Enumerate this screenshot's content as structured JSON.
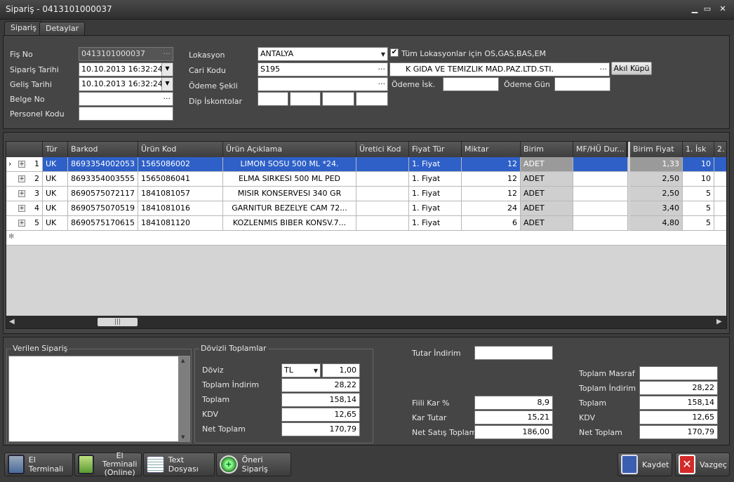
{
  "window": {
    "title": "Sipariş - 0413101000037",
    "min": "▁",
    "max": "▭",
    "close": "✕"
  },
  "tabs": [
    "Sipariş",
    "Detaylar"
  ],
  "header": {
    "fis_no_label": "Fiş No",
    "fis_no": "0413101000037",
    "siparis_tarihi_label": "Sipariş Tarihi",
    "siparis_tarihi": "10.10.2013 16:32:24",
    "gelis_tarihi_label": "Geliş Tarihi",
    "gelis_tarihi": "10.10.2013 16:32:24",
    "belge_no_label": "Belge No",
    "belge_no": "",
    "personel_kodu_label": "Personel Kodu",
    "personel_kodu": "",
    "lokasyon_label": "Lokasyon",
    "lokasyon": "ANTALYA",
    "tum_lokasyon_label": "Tüm Lokasyonlar için OS,GAS,BAS,EM",
    "cari_kodu_label": "Cari Kodu",
    "cari_kodu": "S195",
    "cari_unvan": "K GIDA VE TEMIZLIK MAD.PAZ.LTD.STI.",
    "akil_kupu": "Akıl Küpü",
    "odeme_sekli_label": "Ödeme Şekli",
    "odeme_sekli": "",
    "odeme_isk_label": "Ödeme İsk.",
    "odeme_gun_label": "Ödeme Gün",
    "dip_iskontolar_label": "Dip İskontolar"
  },
  "grid": {
    "columns": [
      "Tür",
      "Barkod",
      "Ürün Kod",
      "Ürün Açıklama",
      "Üretici Kod",
      "Fiyat Tür",
      "Miktar",
      "Birim",
      "MF/HÜ Dur...",
      "Birim Fiyat",
      "1. İsk",
      "2."
    ],
    "rows": [
      {
        "no": "1",
        "tur": "UK",
        "barkod": "8693354002053",
        "urun_kod": "1565086002",
        "aciklama": "LIMON SOSU 500 ML *24.",
        "uretici": "",
        "fiyat_tur": "1. Fiyat",
        "miktar": "12",
        "birim": "ADET",
        "mf": "",
        "birim_fiyat": "1,33",
        "isk1": "10"
      },
      {
        "no": "2",
        "tur": "UK",
        "barkod": "8693354003555",
        "urun_kod": "1565086041",
        "aciklama": "ELMA SIRKESI 500 ML PED",
        "uretici": "",
        "fiyat_tur": "1. Fiyat",
        "miktar": "12",
        "birim": "ADET",
        "mf": "",
        "birim_fiyat": "2,50",
        "isk1": "10"
      },
      {
        "no": "3",
        "tur": "UK",
        "barkod": "8690575072117",
        "urun_kod": "1841081057",
        "aciklama": "MISIR KONSERVESI 340 GR",
        "uretici": "",
        "fiyat_tur": "1. Fiyat",
        "miktar": "12",
        "birim": "ADET",
        "mf": "",
        "birim_fiyat": "2,50",
        "isk1": "5"
      },
      {
        "no": "4",
        "tur": "UK",
        "barkod": "8690575070519",
        "urun_kod": "1841081016",
        "aciklama": "GARNITUR BEZELYE CAM 72...",
        "uretici": "",
        "fiyat_tur": "1. Fiyat",
        "miktar": "24",
        "birim": "ADET",
        "mf": "",
        "birim_fiyat": "3,40",
        "isk1": "5"
      },
      {
        "no": "5",
        "tur": "UK",
        "barkod": "8690575170615",
        "urun_kod": "1841081120",
        "aciklama": "KOZLENMIS BIBER KONSV.7...",
        "uretici": "",
        "fiyat_tur": "1. Fiyat",
        "miktar": "6",
        "birim": "ADET",
        "mf": "",
        "birim_fiyat": "4,80",
        "isk1": "5"
      }
    ]
  },
  "verilen_siparis": {
    "title": "Verilen Sipariş"
  },
  "dovizli": {
    "title": "Dövizli Toplamlar",
    "doviz_label": "Döviz",
    "doviz": "TL",
    "kur": "1,00",
    "toplam_indirim_label": "Toplam İndirim",
    "toplam_indirim": "28,22",
    "toplam_label": "Toplam",
    "toplam": "158,14",
    "kdv_label": "KDV",
    "kdv": "12,65",
    "net_toplam_label": "Net Toplam",
    "net_toplam": "170,79"
  },
  "middle": {
    "tutar_indirim_label": "Tutar İndirim",
    "tutar_indirim": "",
    "fiili_kar_label": "Fiili Kar %",
    "fiili_kar": "8,9",
    "kar_tutar_label": "Kar Tutar",
    "kar_tutar": "15,21",
    "net_satis_label": "Net Satış Toplam",
    "net_satis": "186,00"
  },
  "right": {
    "toplam_masraf_label": "Toplam Masraf",
    "toplam_masraf": "",
    "toplam_indirim_label": "Toplam İndirim",
    "toplam_indirim": "28,22",
    "toplam_label": "Toplam",
    "toplam": "158,14",
    "kdv_label": "KDV",
    "kdv": "12,65",
    "net_toplam_label": "Net Toplam",
    "net_toplam": "170,79"
  },
  "buttons": {
    "el_terminali": "El Terminali",
    "el_terminali_online_1": "El Terminali",
    "el_terminali_online_2": "(Online)",
    "text_dosyasi": "Text Dosyası",
    "oneri_siparis": "Öneri Sipariş",
    "kaydet": "Kaydet",
    "vazgec": "Vazgeç"
  },
  "colors": {
    "selection": "#2e60c8",
    "save_icon": "#3a5fb0",
    "cancel_icon": "#d42a2a"
  }
}
